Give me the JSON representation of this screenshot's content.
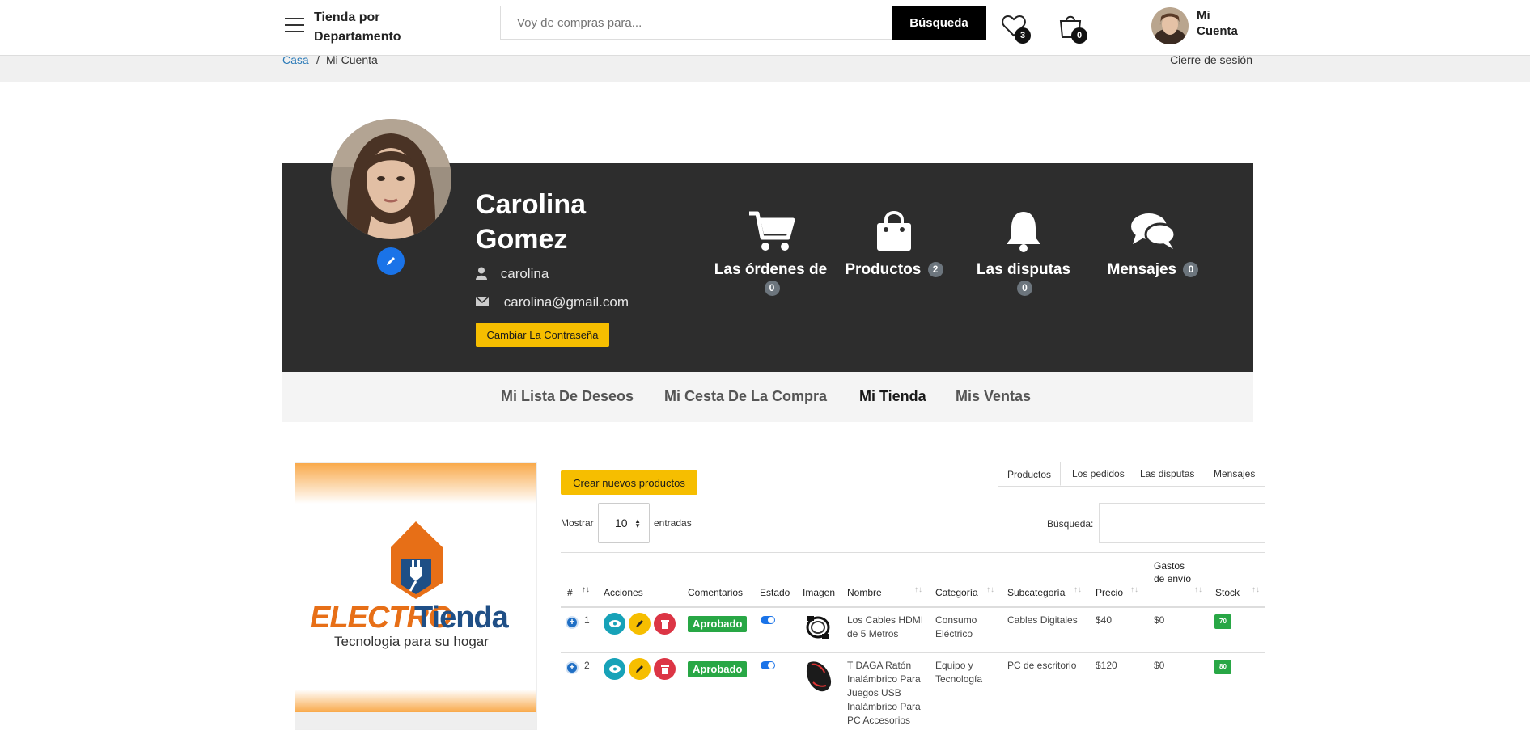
{
  "header": {
    "department": "Tienda por Departamento",
    "search_placeholder": "Voy de compras para...",
    "search_button": "Búsqueda",
    "wishlist_count": "3",
    "cart_count": "0",
    "account": "Mi Cuenta"
  },
  "breadcrumb": {
    "home": "Casa",
    "separator": "/",
    "current": "Mi Cuenta",
    "logout": "Cierre de sesión"
  },
  "profile": {
    "name": "Carolina Gomez",
    "username": "carolina",
    "email": "carolina@gmail.com",
    "change_password": "Cambiar La Contraseña"
  },
  "stats": [
    {
      "label": "Las órdenes de",
      "count": "0",
      "icon": "cart-icon"
    },
    {
      "label": "Productos",
      "count": "2",
      "icon": "shopping-bag-icon"
    },
    {
      "label": "Las disputas",
      "count": "0",
      "icon": "bell-icon"
    },
    {
      "label": "Mensajes",
      "count": "0",
      "icon": "chat-icon"
    }
  ],
  "account_tabs": [
    "Mi Lista De Deseos",
    "Mi Cesta De La Compra",
    "Mi Tienda",
    "Mis Ventas"
  ],
  "active_account_tab": "Mi Tienda",
  "store": {
    "logo_word_a": "ELECTRO",
    "logo_word_b": "Tienda",
    "logo_tagline": "Tecnologia para su hogar"
  },
  "products_panel": {
    "create_button": "Crear nuevos productos",
    "tabs": [
      "Productos",
      "Los pedidos",
      "Las disputas",
      "Mensajes"
    ],
    "active_tab": "Productos",
    "show_label": "Mostrar",
    "page_length": "10",
    "entries_label": "entradas",
    "search_label": "Búsqueda:",
    "columns": [
      "#",
      "Acciones",
      "Comentarios",
      "Estado",
      "Imagen",
      "Nombre",
      "Categoría",
      "Subcategoría",
      "Precio",
      "Gastos de envío",
      "Stock"
    ],
    "rows": [
      {
        "num": "1",
        "status": "Aprobado",
        "name": "Los Cables HDMI de 5 Metros",
        "category": "Consumo Eléctrico",
        "subcategory": "Cables Digitales",
        "price": "$40",
        "shipping": "$0",
        "stock": "70"
      },
      {
        "num": "2",
        "status": "Aprobado",
        "name": "T DAGA Ratón Inalámbrico Para Juegos USB Inalámbrico Para PC Accesorios",
        "category": "Equipo y Tecnología",
        "subcategory": "PC de escritorio",
        "price": "$120",
        "shipping": "$0",
        "stock": "80"
      }
    ]
  },
  "colors": {
    "banner": "#2d2d2d",
    "accent_yellow": "#f6be00",
    "approved_green": "#28a745",
    "link_blue": "#2a7ab8"
  }
}
